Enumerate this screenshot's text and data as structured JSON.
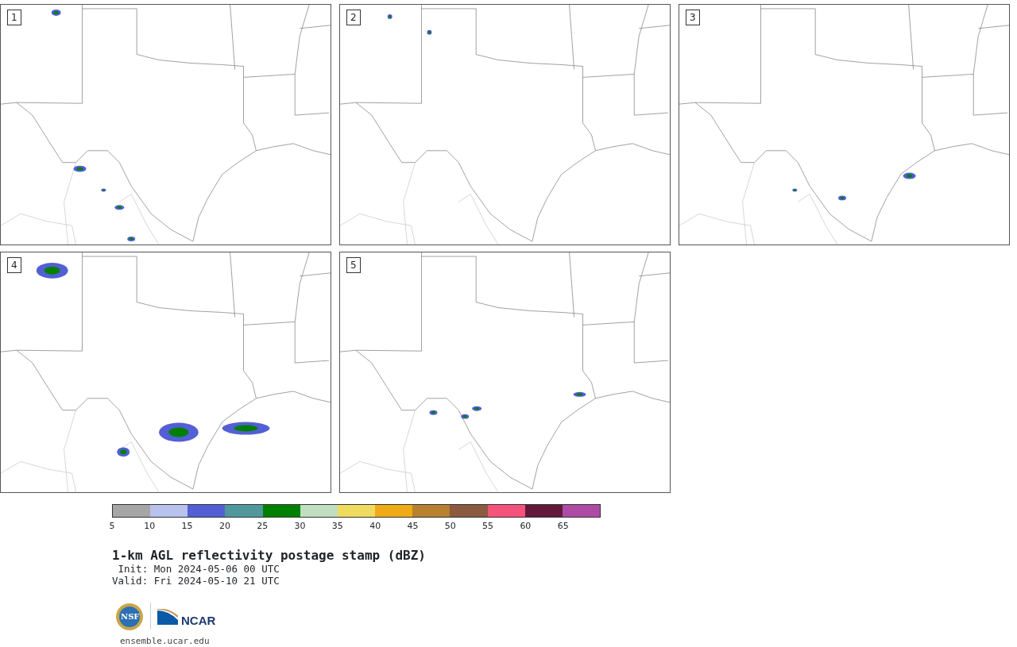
{
  "panels": [
    {
      "label": "1"
    },
    {
      "label": "2"
    },
    {
      "label": "3"
    },
    {
      "label": "4"
    },
    {
      "label": "5"
    }
  ],
  "colorbar": {
    "segments": [
      {
        "color": "#a6a6a6"
      },
      {
        "color": "#b8c2ec"
      },
      {
        "color": "#535fd4"
      },
      {
        "color": "#50989c"
      },
      {
        "color": "#008000"
      },
      {
        "color": "#bfdfbf"
      },
      {
        "color": "#efdc5f"
      },
      {
        "color": "#efab16"
      },
      {
        "color": "#b7812f"
      },
      {
        "color": "#8b5a3f"
      },
      {
        "color": "#f4537c"
      },
      {
        "color": "#63193a"
      },
      {
        "color": "#ae4ba4"
      }
    ],
    "ticks": [
      "5",
      "10",
      "15",
      "20",
      "25",
      "30",
      "35",
      "40",
      "45",
      "50",
      "55",
      "60",
      "65"
    ]
  },
  "title": "1-km AGL reflectivity postage stamp (dBZ)",
  "init": " Init: Mon 2024-05-06 00 UTC",
  "valid": "Valid: Fri 2024-05-10 21 UTC",
  "logos": {
    "left": "NSF",
    "right": "NCAR"
  },
  "url": "ensemble.ucar.edu"
}
